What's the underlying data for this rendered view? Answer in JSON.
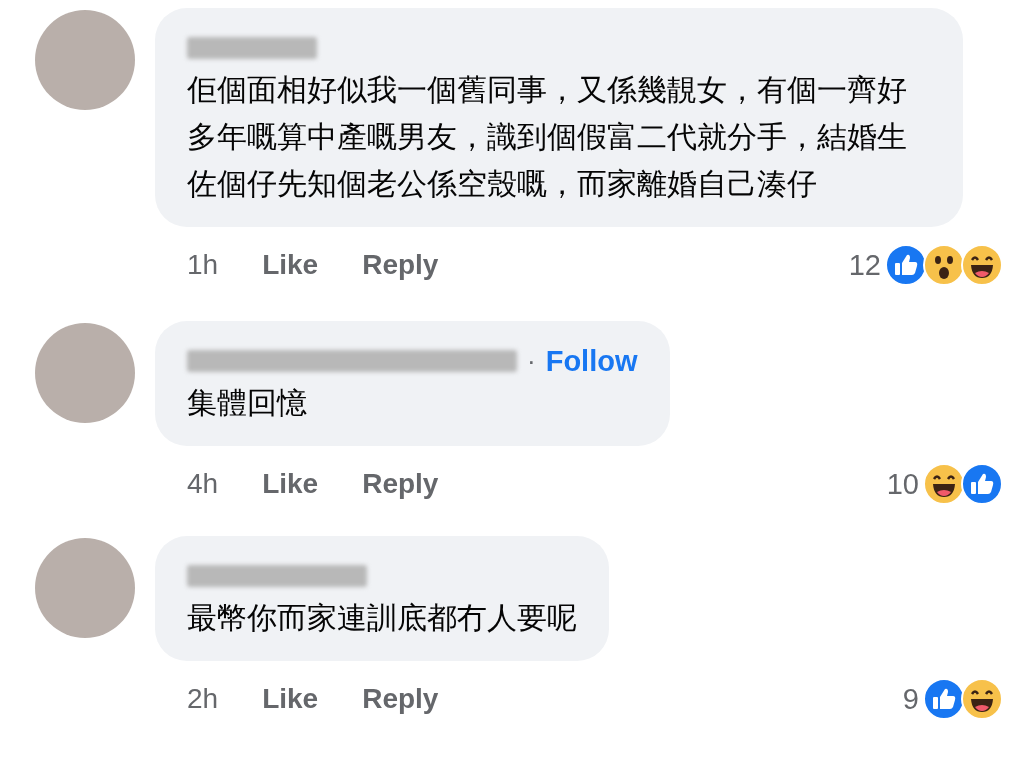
{
  "comments": [
    {
      "text": "佢個面相好似我一個舊同事，又係幾靚女，有個一齊好多年嘅算中產嘅男友，識到個假富二代就分手，結婚生佐個仔先知個老公係空殼嘅，而家離婚自己湊仔",
      "time": "1h",
      "like": "Like",
      "reply": "Reply",
      "reaction_count": "12",
      "reactions": [
        {
          "kind": "like"
        },
        {
          "kind": "wow"
        },
        {
          "kind": "haha"
        }
      ]
    },
    {
      "text": "集體回憶",
      "follow": {
        "separator": "·",
        "label": "Follow"
      },
      "time": "4h",
      "like": "Like",
      "reply": "Reply",
      "reaction_count": "10",
      "reactions": [
        {
          "kind": "haha"
        },
        {
          "kind": "like"
        }
      ]
    },
    {
      "text": "最幣你而家連訓底都冇人要呢",
      "time": "2h",
      "like": "Like",
      "reply": "Reply",
      "reaction_count": "9",
      "reactions": [
        {
          "kind": "like"
        },
        {
          "kind": "haha"
        }
      ]
    }
  ]
}
